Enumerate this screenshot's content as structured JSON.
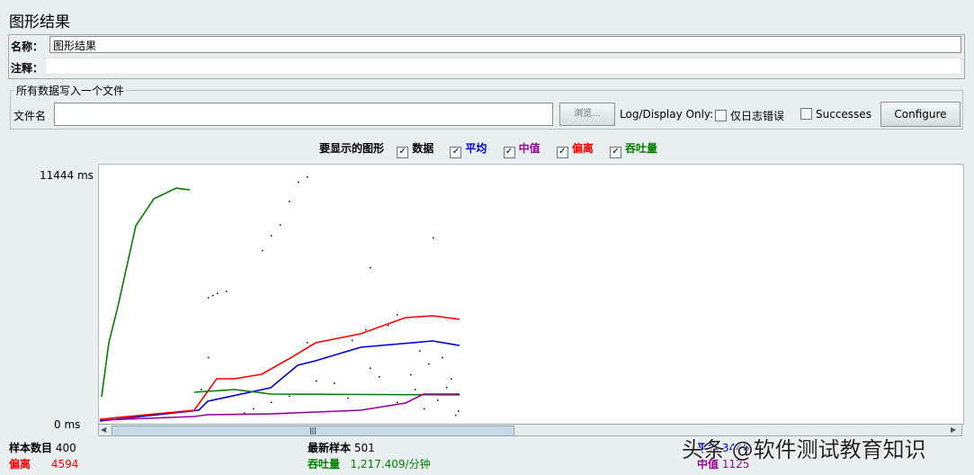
{
  "title": "图形结果",
  "name_label": "名称：",
  "name_value": "图形结果",
  "comment_label": "注释：",
  "comment_value": "",
  "file_group": "所有数据写入一个文件",
  "file_label": "文件名",
  "file_value": "",
  "browse": "浏览...",
  "log_display": "Log/Display Only:",
  "errors_only": "仅日志错误",
  "successes": "Successes",
  "configure": "Configure",
  "graphs_label": "要显示的图形",
  "graphs": [
    {
      "label": "数据",
      "color": "#000000",
      "checked": true
    },
    {
      "label": "平均",
      "color": "#0000cc",
      "checked": true
    },
    {
      "label": "中值",
      "color": "#990099",
      "checked": true
    },
    {
      "label": "偏离",
      "color": "#ff0000",
      "checked": true
    },
    {
      "label": "吞吐量",
      "color": "#008000",
      "checked": true
    }
  ],
  "stats": {
    "samples_label": "样本数目",
    "samples": "400",
    "latest_label": "最新样本",
    "latest": "501",
    "average_label": "平均",
    "average": "3446",
    "deviation_label": "偏离",
    "deviation": "4594",
    "throughput_label": "吞吐量",
    "throughput": "1,217.409/分钟",
    "median_label": "中值",
    "median": "1125"
  },
  "watermark": "头条 @软件测试教育知识",
  "chart_data": {
    "type": "line",
    "y_max_label": "11444  ms",
    "y_min_label": "0  ms",
    "ylim": [
      0,
      11444
    ],
    "xlim": [
      0,
      960
    ],
    "series": [
      {
        "name": "平均",
        "color": "#0000cc",
        "points": [
          [
            0,
            0
          ],
          [
            110,
            505
          ],
          [
            120,
            925
          ],
          [
            190,
            1556
          ],
          [
            220,
            2608
          ],
          [
            240,
            2818
          ],
          [
            290,
            3450
          ],
          [
            370,
            3744
          ],
          [
            400,
            3534
          ]
        ]
      },
      {
        "name": "偏离",
        "color": "#ff0000",
        "points": [
          [
            0,
            84
          ],
          [
            105,
            505
          ],
          [
            130,
            1977
          ],
          [
            150,
            1977
          ],
          [
            180,
            2188
          ],
          [
            210,
            2903
          ],
          [
            240,
            3660
          ],
          [
            290,
            4081
          ],
          [
            340,
            4838
          ],
          [
            370,
            4922
          ],
          [
            400,
            4754
          ]
        ]
      },
      {
        "name": "吞吐量",
        "color": "#008000",
        "points": [
          [
            2,
            1136
          ],
          [
            10,
            3660
          ],
          [
            20,
            5343
          ],
          [
            40,
            9129
          ],
          [
            60,
            10391
          ],
          [
            85,
            10896
          ],
          [
            100,
            10812
          ]
        ],
        "points2": [
          [
            105,
            1346
          ],
          [
            150,
            1472
          ],
          [
            190,
            1262
          ],
          [
            400,
            1220
          ]
        ]
      },
      {
        "name": "中值",
        "color": "#990099",
        "points": [
          [
            0,
            42
          ],
          [
            105,
            210
          ],
          [
            120,
            294
          ],
          [
            190,
            336
          ],
          [
            290,
            505
          ],
          [
            340,
            842
          ],
          [
            360,
            1262
          ],
          [
            400,
            1262
          ]
        ]
      }
    ],
    "data_points": [
      [
        120,
        5800
      ],
      [
        125,
        5900
      ],
      [
        130,
        6000
      ],
      [
        140,
        6100
      ],
      [
        180,
        8000
      ],
      [
        190,
        8700
      ],
      [
        200,
        9200
      ],
      [
        210,
        10300
      ],
      [
        220,
        11200
      ],
      [
        230,
        11444
      ],
      [
        230,
        3700
      ],
      [
        250,
        3000
      ],
      [
        280,
        3800
      ],
      [
        300,
        2500
      ],
      [
        320,
        4500
      ],
      [
        350,
        1500
      ],
      [
        370,
        8600
      ],
      [
        380,
        3000
      ],
      [
        390,
        2000
      ],
      [
        345,
        2200
      ],
      [
        295,
        4300
      ],
      [
        260,
        1800
      ],
      [
        160,
        400
      ],
      [
        170,
        600
      ],
      [
        190,
        900
      ],
      [
        210,
        1200
      ],
      [
        240,
        1900
      ],
      [
        275,
        1100
      ],
      [
        310,
        2100
      ],
      [
        330,
        900
      ],
      [
        360,
        600
      ],
      [
        395,
        300
      ],
      [
        385,
        1600
      ],
      [
        300,
        7200
      ],
      [
        330,
        5000
      ],
      [
        355,
        3300
      ],
      [
        365,
        2700
      ],
      [
        375,
        1000
      ],
      [
        398,
        500
      ],
      [
        120,
        3000
      ],
      [
        112,
        1500
      ]
    ]
  }
}
